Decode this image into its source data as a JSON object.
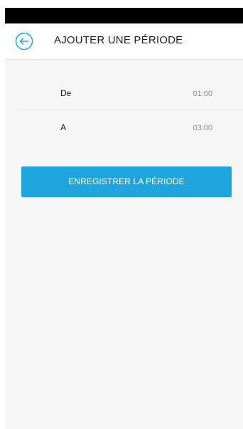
{
  "header": {
    "title": "AJOUTER UNE PÉRIODE",
    "back_icon": "arrow-left-circle-icon"
  },
  "period": {
    "rows": [
      {
        "label": "De",
        "value": "01:00"
      },
      {
        "label": "A",
        "value": "03:00"
      }
    ]
  },
  "actions": {
    "save_label": "ENREGISTRER LA PÉRIODE"
  },
  "colors": {
    "accent": "#1ea5dd",
    "background": "#f6f6f6",
    "status_bar": "#000000"
  }
}
